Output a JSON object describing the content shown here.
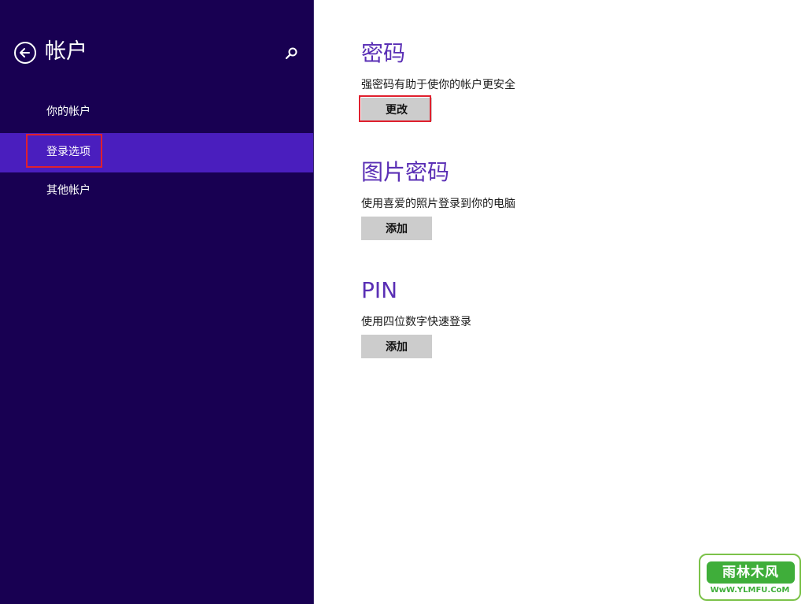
{
  "sidebar": {
    "title": "帐户",
    "back_icon": "back-arrow-icon",
    "search_icon": "search-icon",
    "items": [
      {
        "label": "你的帐户",
        "selected": false
      },
      {
        "label": "登录选项",
        "selected": true
      },
      {
        "label": "其他帐户",
        "selected": false
      }
    ]
  },
  "sections": [
    {
      "heading": "密码",
      "description": "强密码有助于使你的帐户更安全",
      "button_label": "更改"
    },
    {
      "heading": "图片密码",
      "description": "使用喜爱的照片登录到你的电脑",
      "button_label": "添加"
    },
    {
      "heading": "PIN",
      "description": "使用四位数字快速登录",
      "button_label": "添加"
    }
  ],
  "watermark": {
    "main_text": "雨林木风",
    "url": "WwW.YLMFU.CoM"
  },
  "colors": {
    "sidebar_bg": "#180052",
    "selected_item_bg": "#4a1ebe",
    "heading_accent": "#5a2fb5",
    "highlight_border": "#e0202e",
    "button_bg": "#cccccc"
  }
}
